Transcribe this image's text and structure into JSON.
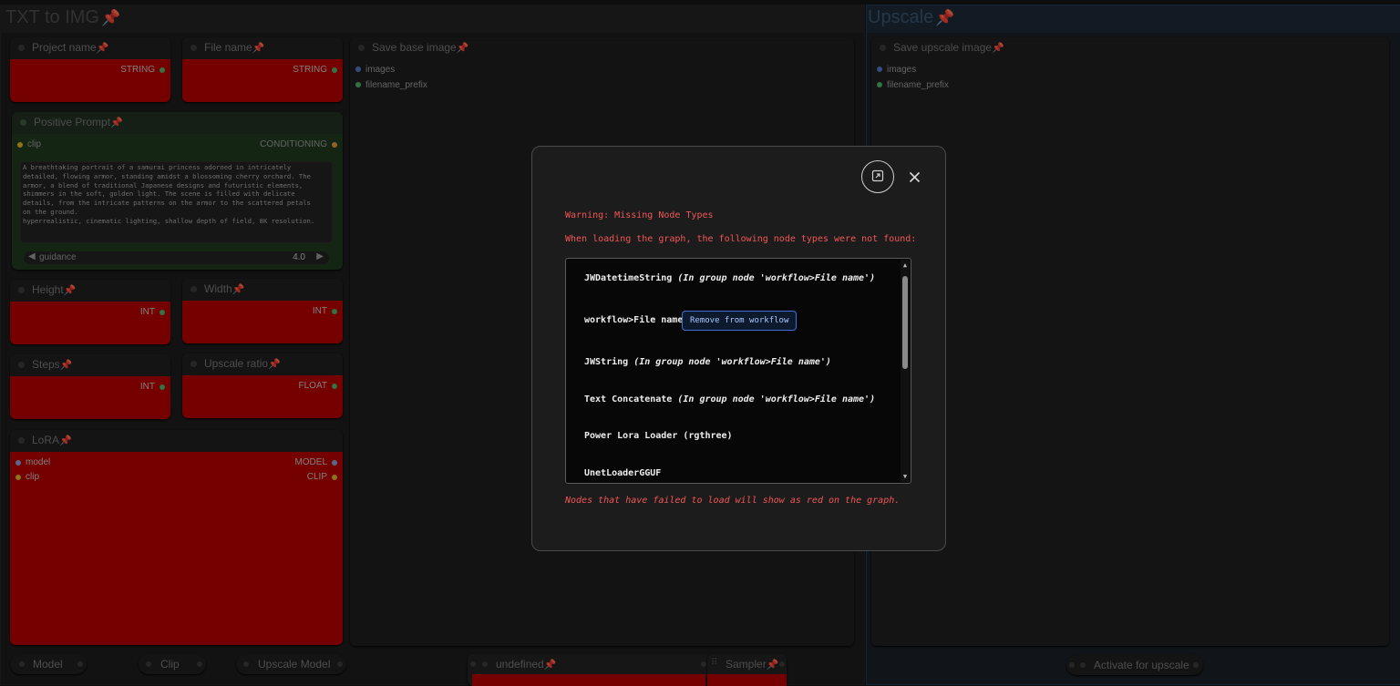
{
  "canvas": {
    "groups": {
      "txt2img": {
        "title": "TXT to IMG"
      },
      "upscale": {
        "title": "Upscale"
      }
    },
    "nodes": {
      "project_name": {
        "title": "Project name",
        "output": "STRING"
      },
      "file_name": {
        "title": "File name",
        "output": "STRING"
      },
      "save_base": {
        "title": "Save base image",
        "inputs": [
          "images",
          "filename_prefix"
        ]
      },
      "save_upscale": {
        "title": "Save upscale image",
        "inputs": [
          "images",
          "filename_prefix"
        ]
      },
      "positive_prompt": {
        "title": "Positive Prompt",
        "input": "clip",
        "output": "CONDITIONING",
        "text": "A breathtaking portrait of a samurai princess adorned in intricately\ndetailed, flowing armor, standing amidst a blossoming cherry orchard. The\narmor, a blend of traditional Japanese designs and futuristic elements,\nshimmers in the soft, golden light. The scene is filled with delicate\ndetails, from the intricate patterns on the armor to the scattered petals\non the ground.\nhyperrealistic, cinematic lighting, shallow depth of field, 8K resolution.",
        "widget_label": "guidance",
        "widget_value": "4.0"
      },
      "height": {
        "title": "Height",
        "output": "INT"
      },
      "width": {
        "title": "Width",
        "output": "INT"
      },
      "steps": {
        "title": "Steps",
        "output": "INT"
      },
      "upscale_ratio": {
        "title": "Upscale ratio",
        "output": "FLOAT"
      },
      "lora": {
        "title": "LoRA",
        "inputs": [
          "model",
          "clip"
        ],
        "outputs": [
          "MODEL",
          "CLIP"
        ]
      },
      "model": {
        "title": "Model"
      },
      "clip": {
        "title": "Clip"
      },
      "upscale_model": {
        "title": "Upscale Model"
      },
      "undefined": {
        "title": "undefined"
      },
      "sampler": {
        "title": "Sampler"
      },
      "activate_upscale": {
        "title": "Activate for upscale"
      }
    }
  },
  "dialog": {
    "warning_title": "Warning: Missing Node Types",
    "warning_desc": "When loading the graph, the following node types were not found:",
    "items": [
      {
        "name": "JWDatetimeString",
        "detail": "(In group node 'workflow>File name')"
      },
      {
        "name": "workflow>File name",
        "action": "Remove from workflow"
      },
      {
        "name": "JWString",
        "detail": "(In group node 'workflow>File name')"
      },
      {
        "name": "Text Concatenate",
        "detail": "(In group node 'workflow>File name')"
      },
      {
        "name": "Power Lora Loader (rgthree)"
      },
      {
        "name": "UnetLoaderGGUF"
      }
    ],
    "footer_note": "Nodes that have failed to load will show as red on the graph."
  },
  "colors": {
    "error_red": "#b30000",
    "warning_text": "#f25656",
    "pin": "#e32b2b"
  },
  "icons": {
    "pin": "pin-icon",
    "maximize": "maximize-icon",
    "close": "close-icon"
  }
}
